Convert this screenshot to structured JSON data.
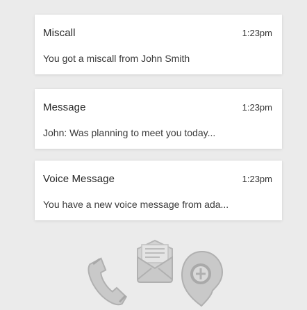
{
  "notifications": [
    {
      "title": "Miscall",
      "time": "1:23pm",
      "body": "You got a miscall from John Smith"
    },
    {
      "title": "Message",
      "time": "1:23pm",
      "body": "John: Was planning to meet you today..."
    },
    {
      "title": "Voice Message",
      "time": "1:23pm",
      "body": "You have a new voice message from ada..."
    }
  ],
  "icons": [
    "phone-icon",
    "mail-envelope-icon",
    "voicemail-icon"
  ],
  "colors": {
    "background": "#ebebeb",
    "card": "#ffffff",
    "icon": "#c9c9c9",
    "icon_shade": "#b3b3b3"
  }
}
